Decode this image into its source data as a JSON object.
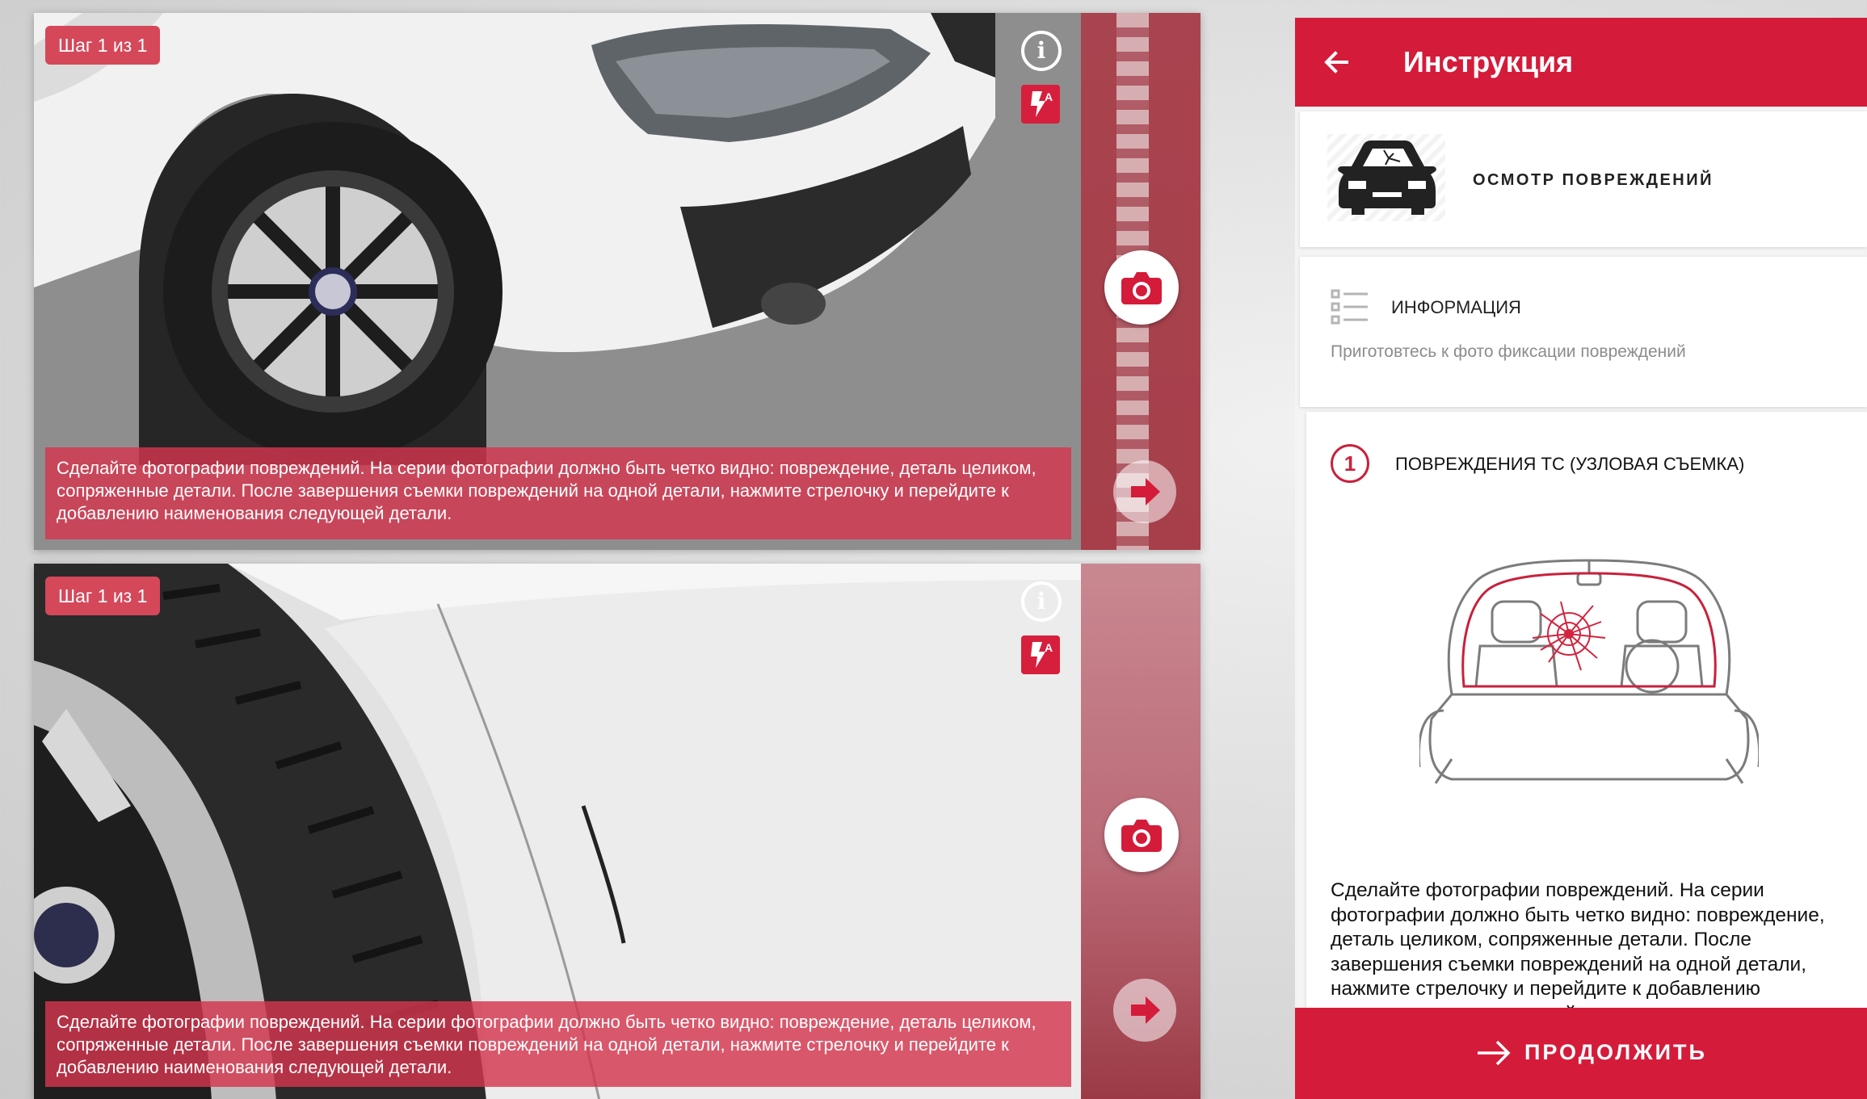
{
  "camera_views": [
    {
      "step_badge": "Шаг 1 из 1",
      "caption": "Сделайте фотографии повреждений. На серии фотографии должно быть четко видно: повреждение, деталь целиком, сопряженные детали. После завершения съемки повреждений на одной детали, нажмите стрелочку и перейдите к добавлению наименования следующей детали."
    },
    {
      "step_badge": "Шаг 1 из 1",
      "caption": "Сделайте фотографии повреждений. На серии фотографии должно быть четко видно: повреждение, деталь целиком, сопряженные детали. После завершения съемки повреждений на одной детали, нажмите стрелочку и перейдите к добавлению наименования следующей детали."
    }
  ],
  "camera_controls": {
    "info_glyph": "i",
    "icons": [
      "info-icon",
      "flash-auto-icon",
      "camera-icon",
      "arrow-right-icon"
    ]
  },
  "panel": {
    "title": "Инструкция",
    "type_card": {
      "label": "ОСМОТР ПОВРЕЖДЕНИЙ",
      "icon": "damaged-car-icon"
    },
    "info_card": {
      "title": "ИНФОРМАЦИЯ",
      "subtitle": "Приготовтесь к фото фиксации повреждений",
      "icon": "list-icon"
    },
    "step_card": {
      "number": "1",
      "title": "ПОВРЕЖДЕНИЯ ТС (УЗЛОВАЯ СЪЕМКА)",
      "text": "Сделайте фотографии повреждений. На серии фотографии должно быть четко видно: повреждение, деталь целиком, сопряженные детали. После завершения съемки повреждений на одной детали, нажмите стрелочку и перейдите к добавлению наименования следующей детали."
    },
    "continue_label": "ПРОДОЛЖИТЬ"
  },
  "colors": {
    "brand_red": "#d51b3a",
    "caption_red": "#d4364e",
    "muted_text": "#8c8c8c"
  }
}
